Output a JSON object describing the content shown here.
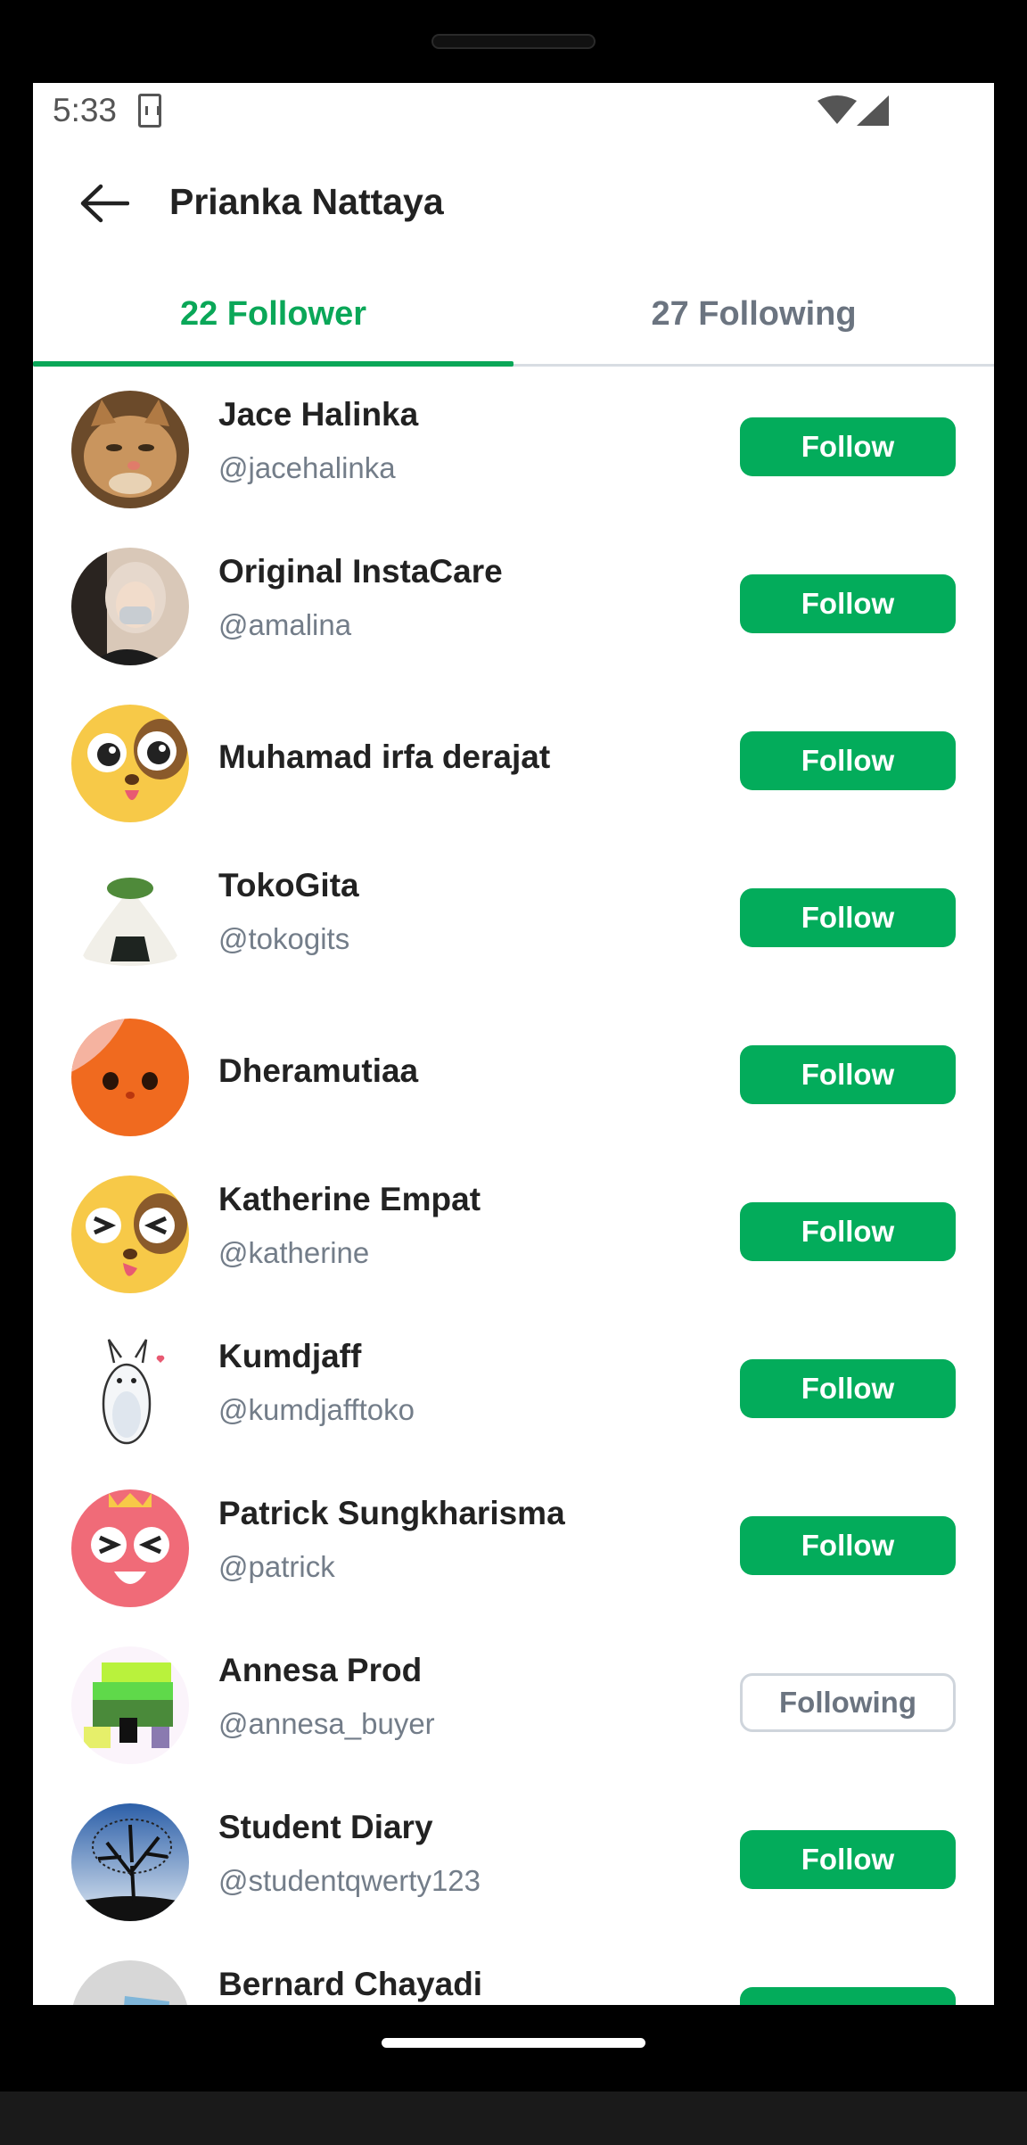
{
  "status_bar": {
    "time": "5:33"
  },
  "header": {
    "title": "Prianka Nattaya"
  },
  "tabs": [
    {
      "label": "22 Follower",
      "active": true
    },
    {
      "label": "27 Following",
      "active": false
    }
  ],
  "colors": {
    "accent": "#03ac5b",
    "text": "#222222",
    "muted": "#737d89"
  },
  "users": [
    {
      "name": "Jace Halinka",
      "handle": "@jacehalinka",
      "button": "Follow",
      "state": "follow",
      "avatar_icon": "cat-photo-avatar"
    },
    {
      "name": "Original InstaCare",
      "handle": "@amalina",
      "button": "Follow",
      "state": "follow",
      "avatar_icon": "person-photo-avatar"
    },
    {
      "name": "Muhamad irfa derajat",
      "handle": "",
      "button": "Follow",
      "state": "follow",
      "avatar_icon": "yellow-dog-face-avatar"
    },
    {
      "name": "TokoGita",
      "handle": "@tokogits",
      "button": "Follow",
      "state": "follow",
      "avatar_icon": "rice-ball-avatar"
    },
    {
      "name": "Dheramutiaa",
      "handle": "",
      "button": "Follow",
      "state": "follow",
      "avatar_icon": "orange-face-avatar"
    },
    {
      "name": "Katherine Empat",
      "handle": "@katherine",
      "button": "Follow",
      "state": "follow",
      "avatar_icon": "yellow-dog-wink-avatar"
    },
    {
      "name": "Kumdjaff",
      "handle": "@kumdjafftoko",
      "button": "Follow",
      "state": "follow",
      "avatar_icon": "white-rabbit-avatar"
    },
    {
      "name": "Patrick Sungkharisma",
      "handle": "@patrick",
      "button": "Follow",
      "state": "follow",
      "avatar_icon": "pink-face-avatar"
    },
    {
      "name": "Annesa Prod",
      "handle": "@annesa_buyer",
      "button": "Following",
      "state": "following",
      "avatar_icon": "pixel-art-avatar"
    },
    {
      "name": "Student Diary",
      "handle": "@studentqwerty123",
      "button": "Follow",
      "state": "follow",
      "avatar_icon": "tree-photo-avatar"
    },
    {
      "name": "Bernard Chayadi",
      "handle": "",
      "button": "Follow",
      "state": "follow",
      "avatar_icon": "grey-avatar"
    }
  ]
}
